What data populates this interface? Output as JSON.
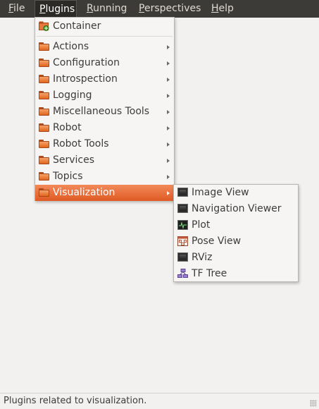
{
  "menubar": {
    "items": [
      {
        "label": "File",
        "mnemonic": "F",
        "rest": "ile"
      },
      {
        "label": "Plugins",
        "mnemonic": "P",
        "rest": "lugins"
      },
      {
        "label": "Running",
        "mnemonic": "R",
        "rest": "unning"
      },
      {
        "label": "Perspectives",
        "mnemonic": "P",
        "rest": "erspectives"
      },
      {
        "label": "Help",
        "mnemonic": "H",
        "rest": "elp"
      }
    ],
    "open_item": "Plugins"
  },
  "plugins_menu": {
    "top_item": {
      "label": "Container",
      "icon": "container-icon"
    },
    "items": [
      {
        "label": "Actions",
        "icon": "folder-icon"
      },
      {
        "label": "Configuration",
        "icon": "folder-icon"
      },
      {
        "label": "Introspection",
        "icon": "folder-icon"
      },
      {
        "label": "Logging",
        "icon": "folder-icon"
      },
      {
        "label": "Miscellaneous Tools",
        "icon": "folder-icon"
      },
      {
        "label": "Robot",
        "icon": "folder-icon"
      },
      {
        "label": "Robot Tools",
        "icon": "folder-icon"
      },
      {
        "label": "Services",
        "icon": "folder-icon"
      },
      {
        "label": "Topics",
        "icon": "folder-icon"
      },
      {
        "label": "Visualization",
        "icon": "folder-icon"
      }
    ],
    "highlighted": "Visualization"
  },
  "visualization_submenu": {
    "items": [
      {
        "label": "Image View",
        "icon": "monitor-icon"
      },
      {
        "label": "Navigation Viewer",
        "icon": "monitor-icon"
      },
      {
        "label": "Plot",
        "icon": "waveform-icon"
      },
      {
        "label": "Pose View",
        "icon": "pose-icon"
      },
      {
        "label": "RViz",
        "icon": "monitor-icon"
      },
      {
        "label": "TF Tree",
        "icon": "tree-graph-icon"
      }
    ]
  },
  "statusbar": {
    "text": "Plugins related to visualization."
  },
  "colors": {
    "menubar_bg": "#3c3b37",
    "highlight": "#e9692c",
    "window_bg": "#f2f1f0"
  }
}
